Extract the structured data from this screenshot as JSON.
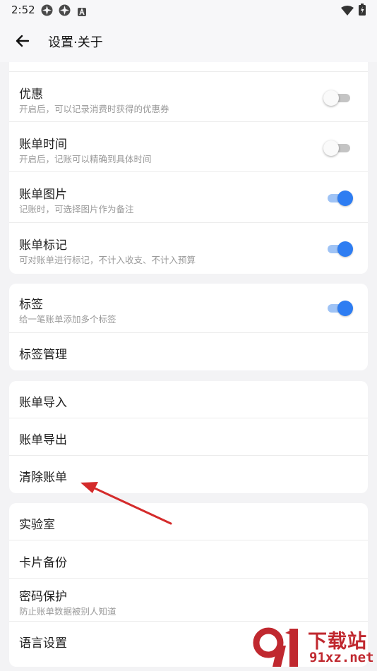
{
  "status_bar": {
    "time": "2:52"
  },
  "header": {
    "title": "设置·关于"
  },
  "section1": {
    "rows": [
      {
        "title": "优惠",
        "subtitle": "开启后，可以记录消费时获得的优惠券",
        "toggle_on": false
      },
      {
        "title": "账单时间",
        "subtitle": "开启后，记账可以精确到具体时间",
        "toggle_on": false
      },
      {
        "title": "账单图片",
        "subtitle": "记账时，可选择图片作为备注",
        "toggle_on": true
      },
      {
        "title": "账单标记",
        "subtitle": "可对账单进行标记，不计入收支、不计入预算",
        "toggle_on": true
      }
    ]
  },
  "section2": {
    "tags": {
      "title": "标签",
      "subtitle": "给一笔账单添加多个标签",
      "toggle_on": true
    },
    "manage": {
      "title": "标签管理"
    }
  },
  "section3": {
    "import": "账单导入",
    "export": "账单导出",
    "clear": "清除账单"
  },
  "section4": {
    "lab": "实验室",
    "card_backup": "卡片备份",
    "password": {
      "title": "密码保护",
      "subtitle": "防止账单数据被别人知道"
    },
    "language": "语言设置"
  },
  "watermark": {
    "brand": "下载站",
    "domain": "91xz.net"
  },
  "colors": {
    "accent": "#2e7df2",
    "annotation_arrow": "#d42b2b",
    "watermark": "#c0282f"
  }
}
